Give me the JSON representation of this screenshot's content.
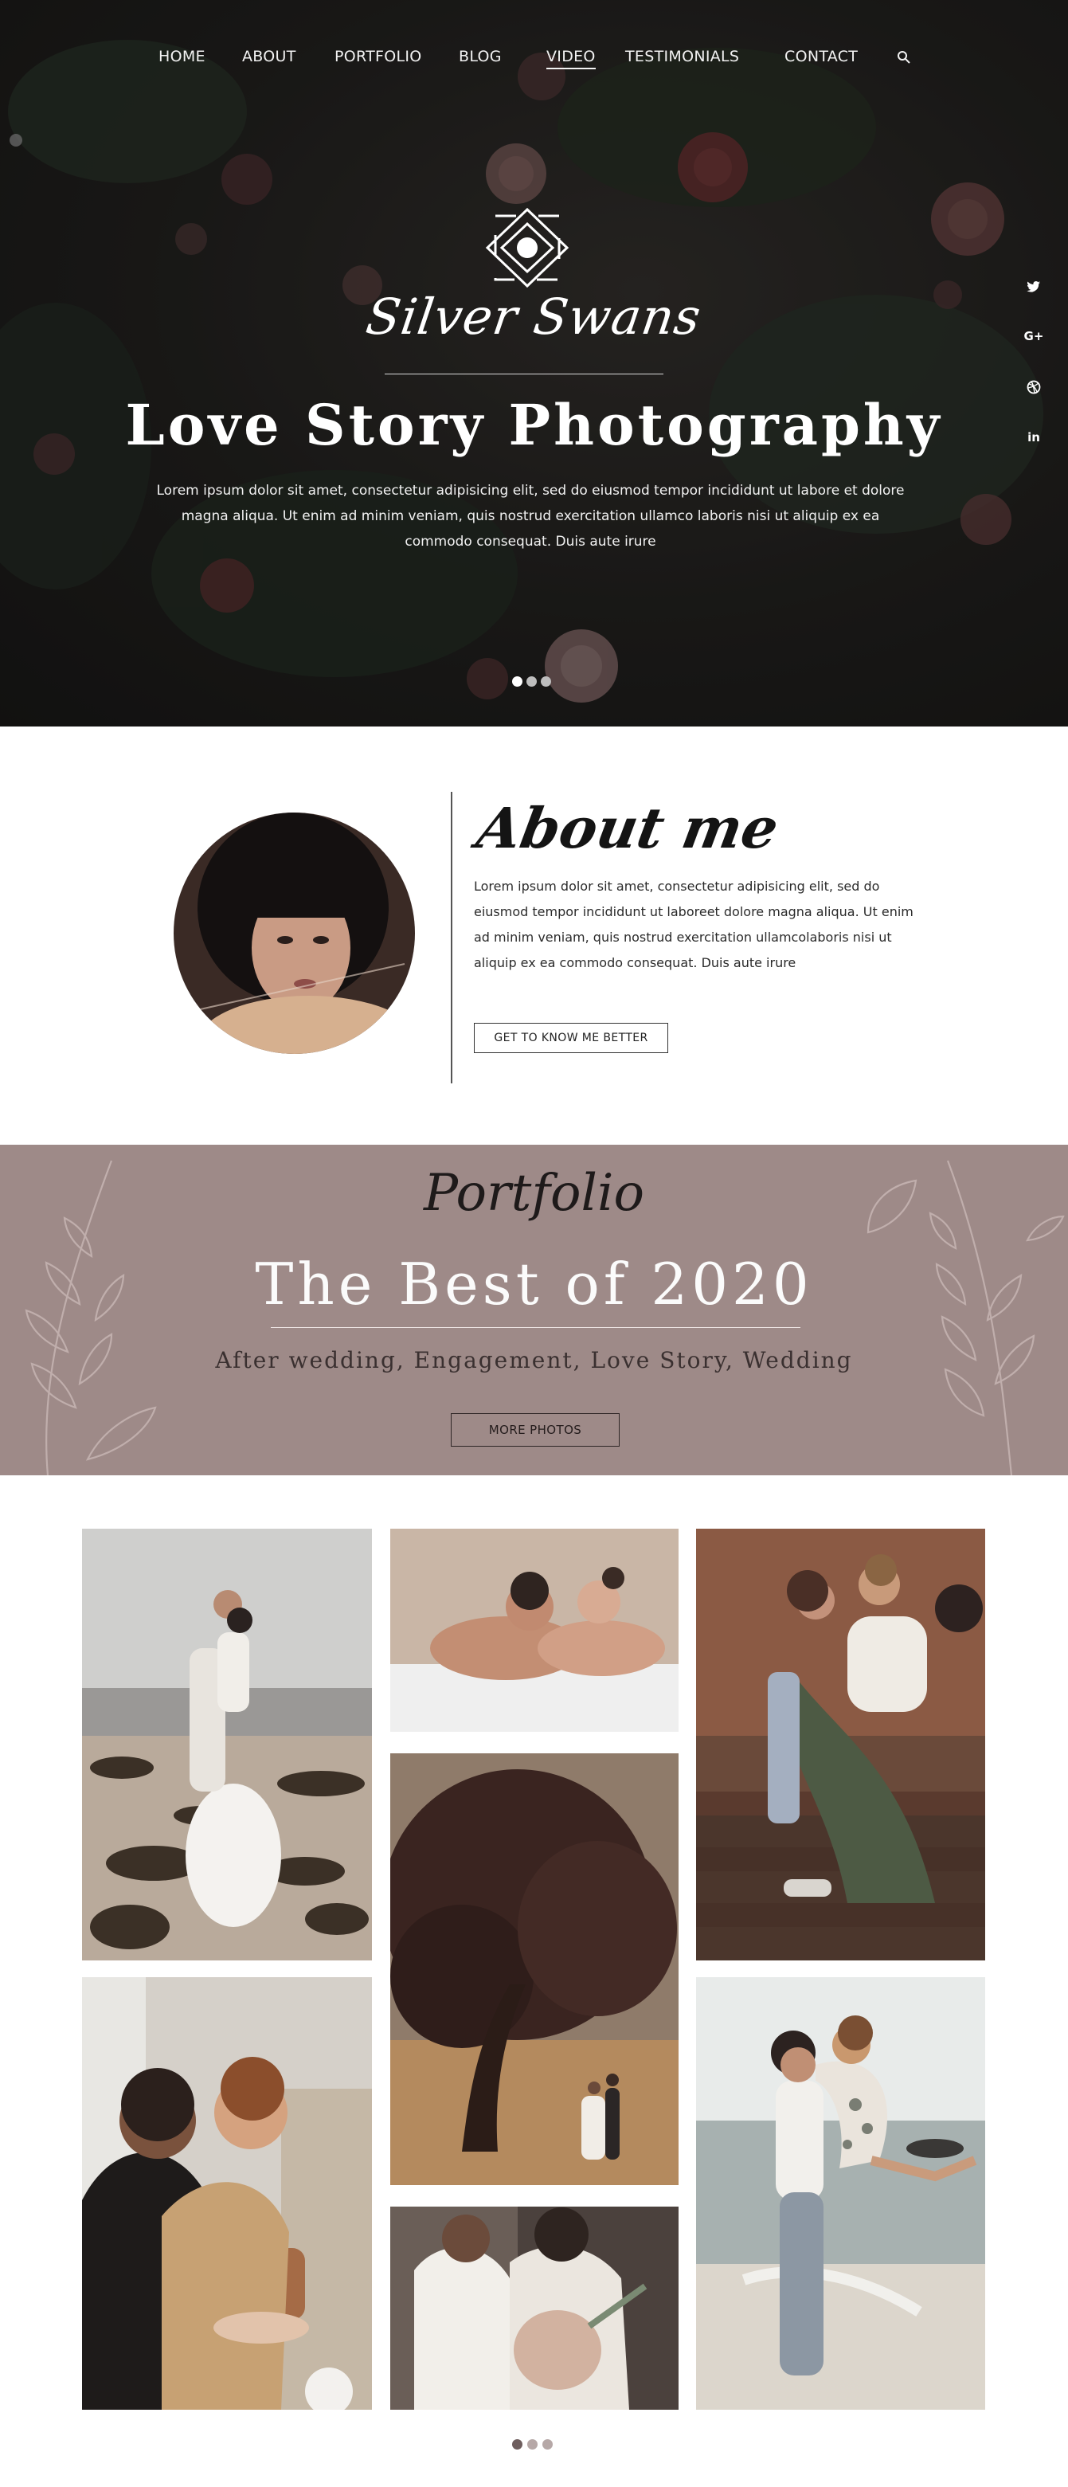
{
  "nav": {
    "items": [
      "HOME",
      "ABOUT",
      "PORTFOLIO",
      "BLOG",
      "VIDEO",
      "TESTIMONIALS",
      "CONTACT"
    ],
    "active": "VIDEO",
    "search_icon": "search-icon"
  },
  "hero": {
    "brand": "Silver Swans",
    "title": "Love Story Photography",
    "text": "Lorem ipsum dolor sit amet, consectetur adipisicing elit, sed do eiusmod tempor incididunt ut labore et dolore magna aliqua. Ut enim ad minim veniam, quis nostrud exercitation ullamco laboris nisi ut aliquip ex ea commodo consequat. Duis aute irure",
    "slider_dots": 3,
    "social_icons": [
      "twitter-icon",
      "google-plus-icon",
      "dribbble-icon",
      "linkedin-icon"
    ],
    "social_glyphs": [
      "t",
      "G+",
      "◎",
      "in"
    ]
  },
  "about": {
    "heading": "About me",
    "text": "Lorem ipsum dolor sit amet, consectetur adipisicing elit, sed do eiusmod tempor incididunt ut laboreet dolore magna aliqua. Ut enim ad minim veniam, quis nostrud exercitation ullamcolaboris nisi ut aliquip ex ea commodo consequat. Duis aute irure",
    "button": "GET TO KNOW ME BETTER"
  },
  "portfolio": {
    "script_heading": "Portfolio",
    "title": "The Best of 2020",
    "subtitle": "After wedding, Engagement, Love Story, Wedding",
    "button": "MORE PHOTOS",
    "band_color": "#9e8a88"
  },
  "gallery": {
    "photos": [
      "beach-couple-rocks-photo",
      "couple-in-bathtub-photo",
      "couple-on-stairs-photo",
      "couple-hugging-kitchen-photo",
      "couple-under-tree-photo",
      "pregnant-couple-photo",
      "couple-jumping-beach-photo"
    ],
    "slider_dots": 3
  },
  "colors": {
    "hero_dark": "#1c1b19",
    "text_light": "#f2f2f2",
    "band": "#9e8a88",
    "dot_active": "#7a6868",
    "dot_inactive": "#b6a8a7"
  }
}
